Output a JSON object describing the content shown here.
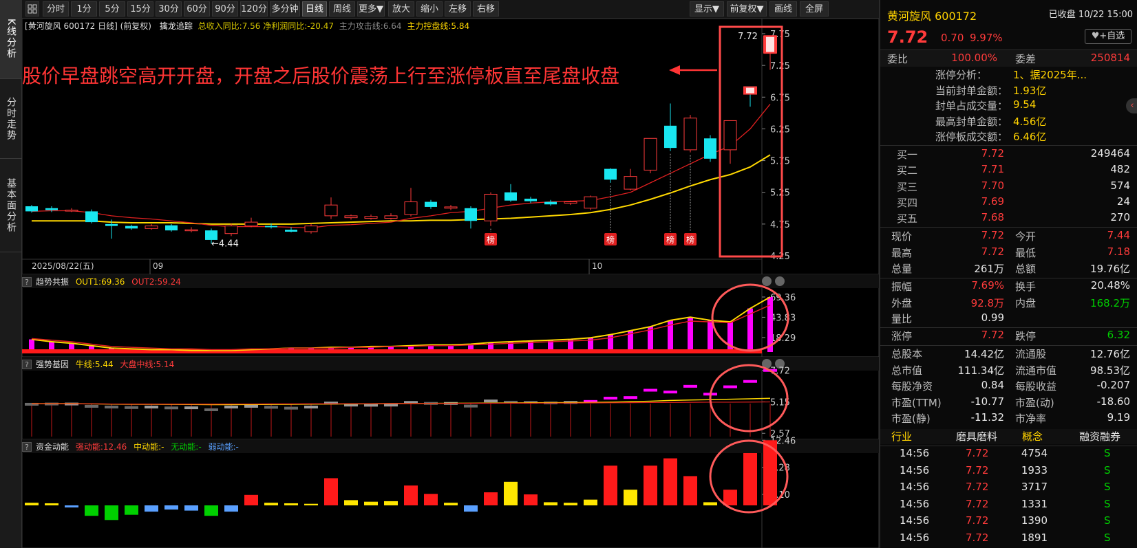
{
  "sidebar": {
    "tabs": [
      {
        "label": "K线分析"
      },
      {
        "label": "分时走势"
      },
      {
        "label": "基本面分析"
      }
    ]
  },
  "toolbar": {
    "periods": [
      "分时",
      "1分",
      "5分",
      "15分",
      "30分",
      "60分",
      "90分",
      "120分",
      "多分钟",
      "日线",
      "周线",
      "更多▼"
    ],
    "active_period": "日线",
    "actions": [
      "放大",
      "缩小",
      "左移",
      "右移"
    ],
    "right_actions": [
      "显示▼",
      "前复权▼",
      "画线",
      "全屏"
    ]
  },
  "main_panel": {
    "title_left": "[黄河旋风 600172 日线]  (前复权)",
    "indicator_name": "擒龙追踪",
    "indicator_values": "总收入同比:7.56  净利润同比:-20.47",
    "attack_line": "主力攻击线:6.64",
    "control_line": "主力控盘线:5.84",
    "price_ticks": [
      "7.75",
      "7.25",
      "6.75",
      "6.25",
      "5.75",
      "5.25",
      "4.75",
      "4.25"
    ],
    "high_label": "7.72",
    "low_label": "←4.44",
    "bang_label": "榜",
    "date_labels": [
      "2025/08/22(五)",
      "09",
      "10"
    ],
    "annotation_text": "股价早盘跳空高开开盘，开盘之后股价震荡上行至涨停板直至尾盘收盘"
  },
  "panel_trend": {
    "name": "趋势共振",
    "out1": "OUT1:69.36",
    "out2": "OUT2:59.24",
    "ticks": [
      "69.36",
      "43.83",
      "18.29"
    ]
  },
  "panel_strong": {
    "name": "强势基因",
    "bull": "牛线:5.44",
    "market": "大盘中线:5.14",
    "ticks": [
      "7.72",
      "5.15",
      "2.57"
    ]
  },
  "panel_fund": {
    "name": "资金动能",
    "strong": "强动能:12.46",
    "mid": "中动能:-",
    "none": "无动能:-",
    "weak": "弱动能:-",
    "ticks": [
      "12.46",
      "7.28",
      "2.10"
    ]
  },
  "colors": {
    "up": "#ff3b3b",
    "down": "#19e6f0",
    "ma1": "#ffd800",
    "ma2": "#e02020",
    "magenta": "#ff00ff"
  },
  "chart_data": {
    "type": "candlestick",
    "ylim": [
      4.25,
      7.75
    ],
    "candles": [
      {
        "o": 5.03,
        "c": 4.95,
        "h": 5.05,
        "l": 4.93
      },
      {
        "o": 5.0,
        "c": 4.97,
        "h": 5.03,
        "l": 4.94
      },
      {
        "o": 4.97,
        "c": 4.97,
        "h": 5.0,
        "l": 4.94
      },
      {
        "o": 4.95,
        "c": 4.78,
        "h": 4.98,
        "l": 4.76
      },
      {
        "o": 4.75,
        "c": 4.72,
        "h": 4.82,
        "l": 4.52
      },
      {
        "o": 4.72,
        "c": 4.68,
        "h": 4.74,
        "l": 4.66
      },
      {
        "o": 4.68,
        "c": 4.72,
        "h": 4.75,
        "l": 4.66
      },
      {
        "o": 4.73,
        "c": 4.65,
        "h": 4.75,
        "l": 4.63
      },
      {
        "o": 4.65,
        "c": 4.66,
        "h": 4.7,
        "l": 4.62
      },
      {
        "o": 4.65,
        "c": 4.5,
        "h": 4.68,
        "l": 4.44
      },
      {
        "o": 4.6,
        "c": 4.72,
        "h": 4.76,
        "l": 4.56
      },
      {
        "o": 4.72,
        "c": 4.78,
        "h": 4.85,
        "l": 4.7
      },
      {
        "o": 4.72,
        "c": 4.7,
        "h": 4.76,
        "l": 4.68
      },
      {
        "o": 4.66,
        "c": 4.63,
        "h": 4.7,
        "l": 4.62
      },
      {
        "o": 4.63,
        "c": 4.72,
        "h": 4.76,
        "l": 4.6
      },
      {
        "o": 4.88,
        "c": 5.05,
        "h": 5.17,
        "l": 4.83
      },
      {
        "o": 4.85,
        "c": 4.88,
        "h": 4.9,
        "l": 4.82
      },
      {
        "o": 4.84,
        "c": 4.87,
        "h": 4.9,
        "l": 4.82
      },
      {
        "o": 4.84,
        "c": 4.88,
        "h": 4.92,
        "l": 4.82
      },
      {
        "o": 4.9,
        "c": 5.1,
        "h": 5.32,
        "l": 4.87
      },
      {
        "o": 5.1,
        "c": 5.02,
        "h": 5.13,
        "l": 4.99
      },
      {
        "o": 5.0,
        "c": 5.02,
        "h": 5.05,
        "l": 4.97
      },
      {
        "o": 5.0,
        "c": 4.8,
        "h": 5.03,
        "l": 4.68
      },
      {
        "o": 4.8,
        "c": 5.22,
        "h": 5.25,
        "l": 4.72
      },
      {
        "o": 5.25,
        "c": 5.12,
        "h": 5.38,
        "l": 5.1
      },
      {
        "o": 5.15,
        "c": 5.11,
        "h": 5.18,
        "l": 5.08
      },
      {
        "o": 5.1,
        "c": 5.06,
        "h": 5.13,
        "l": 5.04
      },
      {
        "o": 5.08,
        "c": 5.1,
        "h": 5.12,
        "l": 5.05
      },
      {
        "o": 5.0,
        "c": 5.18,
        "h": 5.2,
        "l": 4.97
      },
      {
        "o": 5.62,
        "c": 5.45,
        "h": 5.63,
        "l": 5.4
      },
      {
        "o": 5.3,
        "c": 5.5,
        "h": 5.62,
        "l": 5.28
      },
      {
        "o": 5.6,
        "c": 6.1,
        "h": 6.1,
        "l": 5.55
      },
      {
        "o": 6.3,
        "c": 5.95,
        "h": 6.65,
        "l": 5.9
      },
      {
        "o": 5.92,
        "c": 6.42,
        "h": 6.47,
        "l": 5.88
      },
      {
        "o": 6.1,
        "c": 5.78,
        "h": 6.15,
        "l": 5.73
      },
      {
        "o": 5.92,
        "c": 6.38,
        "h": 6.38,
        "l": 5.7
      },
      {
        "o": 6.92,
        "c": 6.82,
        "h": 6.92,
        "l": 6.6
      },
      {
        "o": 7.44,
        "c": 7.72,
        "h": 7.72,
        "l": 7.18
      }
    ],
    "ma_control": [
      4.8,
      4.8,
      4.8,
      4.8,
      4.78,
      4.77,
      4.77,
      4.77,
      4.76,
      4.75,
      4.75,
      4.75,
      4.75,
      4.75,
      4.76,
      4.77,
      4.78,
      4.79,
      4.8,
      4.8,
      4.81,
      4.81,
      4.82,
      4.83,
      4.84,
      4.86,
      4.88,
      4.9,
      4.93,
      4.98,
      5.05,
      5.14,
      5.24,
      5.35,
      5.45,
      5.53,
      5.65,
      5.84
    ],
    "ma_attack": [
      4.95,
      4.96,
      4.96,
      4.93,
      4.88,
      4.85,
      4.83,
      4.8,
      4.77,
      4.73,
      4.71,
      4.71,
      4.71,
      4.7,
      4.69,
      4.73,
      4.74,
      4.76,
      4.78,
      4.84,
      4.88,
      4.93,
      4.95,
      5.0,
      5.05,
      5.08,
      5.1,
      5.11,
      5.12,
      5.18,
      5.25,
      5.4,
      5.55,
      5.7,
      5.85,
      5.98,
      6.25,
      6.64
    ],
    "trend": {
      "out1": [
        16,
        13,
        11,
        8,
        5,
        4,
        3,
        3,
        2,
        2,
        2,
        3,
        4,
        5,
        5,
        6,
        6,
        7,
        7,
        8,
        9,
        9,
        10,
        12,
        13,
        14,
        15,
        16,
        18,
        22,
        27,
        32,
        40,
        44,
        40,
        38,
        55,
        69.36
      ],
      "out2": [
        17,
        15,
        13,
        10,
        7,
        6,
        5,
        4,
        4,
        3,
        3,
        4,
        4,
        5,
        5,
        5,
        6,
        6,
        7,
        7,
        8,
        8,
        9,
        10,
        11,
        12,
        13,
        14,
        15,
        18,
        23,
        28,
        34,
        39,
        38,
        37,
        48,
        59.24
      ],
      "bars": [
        16,
        13,
        11,
        8,
        5,
        4,
        3,
        3,
        2,
        2,
        2,
        3,
        4,
        5,
        5,
        6,
        6,
        7,
        7,
        8,
        9,
        9,
        10,
        12,
        13,
        14,
        15,
        16,
        18,
        22,
        27,
        32,
        40,
        44,
        40,
        38,
        55,
        69.36
      ]
    },
    "strong": {
      "bull": [
        5.0,
        5.0,
        5.0,
        4.98,
        4.96,
        4.95,
        4.95,
        4.94,
        4.93,
        4.92,
        4.92,
        4.93,
        4.94,
        4.95,
        4.96,
        4.97,
        4.98,
        4.99,
        5.0,
        5.01,
        5.02,
        5.03,
        5.04,
        5.05,
        5.06,
        5.07,
        5.08,
        5.09,
        5.1,
        5.12,
        5.16,
        5.2,
        5.26,
        5.3,
        5.33,
        5.36,
        5.4,
        5.44
      ],
      "market": [
        5.0,
        5.0,
        4.99,
        4.98,
        4.97,
        4.96,
        4.96,
        4.96,
        4.96,
        4.96,
        4.97,
        4.97,
        4.98,
        4.98,
        4.99,
        4.99,
        5.0,
        5.0,
        5.01,
        5.01,
        5.02,
        5.02,
        5.03,
        5.03,
        5.04,
        5.04,
        5.05,
        5.05,
        5.06,
        5.07,
        5.08,
        5.09,
        5.1,
        5.11,
        5.12,
        5.12,
        5.13,
        5.14
      ]
    },
    "fund": [
      0.5,
      0.4,
      -0.4,
      -2.0,
      -2.8,
      -1.8,
      -1.2,
      -0.8,
      -1.0,
      -2.0,
      -1.2,
      2.0,
      0.5,
      0.4,
      0.3,
      5.2,
      1.0,
      0.7,
      0.8,
      3.8,
      2.2,
      0.5,
      -1.2,
      2.5,
      4.5,
      2.1,
      0.6,
      0.5,
      1.1,
      7.6,
      3.0,
      7.6,
      9.0,
      5.6,
      0.6,
      3.0,
      10.0,
      12.46
    ]
  },
  "right_panel": {
    "stock_name": "黄河旋风 600172",
    "status": "已收盘 10/22 15:00",
    "price": "7.72",
    "change": "0.70",
    "change_pct": "9.97%",
    "watch_button": "+自选",
    "weibi_label": "委比",
    "weibi": "100.00%",
    "weicha_label": "委差",
    "weicha": "250814",
    "limit_analysis": [
      {
        "k": "涨停分析：",
        "v": "1、据2025年..."
      },
      {
        "k": "当前封单金额：",
        "v": "1.93亿"
      },
      {
        "k": "封单占成交量：",
        "v": "9.54"
      },
      {
        "k": "最高封单金额：",
        "v": "4.56亿"
      },
      {
        "k": "涨停板成交额：",
        "v": "6.46亿"
      }
    ],
    "bids": [
      {
        "k": "买一",
        "p": "7.72",
        "v": "249464"
      },
      {
        "k": "买二",
        "p": "7.71",
        "v": "482"
      },
      {
        "k": "买三",
        "p": "7.70",
        "v": "574"
      },
      {
        "k": "买四",
        "p": "7.69",
        "v": "24"
      },
      {
        "k": "买五",
        "p": "7.68",
        "v": "270"
      }
    ],
    "stats1": [
      {
        "l1": "现价",
        "v1": "7.72",
        "c1": "red",
        "l2": "今开",
        "v2": "7.44",
        "c2": "red"
      },
      {
        "l1": "最高",
        "v1": "7.72",
        "c1": "red",
        "l2": "最低",
        "v2": "7.18",
        "c2": "red"
      },
      {
        "l1": "总量",
        "v1": "261万",
        "c1": "wht",
        "l2": "总额",
        "v2": "19.76亿",
        "c2": "wht"
      }
    ],
    "stats2": [
      {
        "l1": "振幅",
        "v1": "7.69%",
        "c1": "red",
        "l2": "换手",
        "v2": "20.48%",
        "c2": "wht"
      },
      {
        "l1": "外盘",
        "v1": "92.8万",
        "c1": "red",
        "l2": "内盘",
        "v2": "168.2万",
        "c2": "grn"
      },
      {
        "l1": "量比",
        "v1": "0.99",
        "c1": "wht",
        "l2": "",
        "v2": "",
        "c2": "wht"
      }
    ],
    "stats3": [
      {
        "l1": "涨停",
        "v1": "7.72",
        "c1": "red",
        "l2": "跌停",
        "v2": "6.32",
        "c2": "grn"
      }
    ],
    "stats4": [
      {
        "l1": "总股本",
        "v1": "14.42亿",
        "c1": "wht",
        "l2": "流通股",
        "v2": "12.76亿",
        "c2": "wht"
      },
      {
        "l1": "总市值",
        "v1": "111.34亿",
        "c1": "wht",
        "l2": "流通市值",
        "v2": "98.53亿",
        "c2": "wht"
      },
      {
        "l1": "每股净资",
        "v1": "0.84",
        "c1": "wht",
        "l2": "每股收益",
        "v2": "-0.207",
        "c2": "wht"
      },
      {
        "l1": "市盈(TTM)",
        "v1": "-10.77",
        "c1": "wht",
        "l2": "市盈(动)",
        "v2": "-18.60",
        "c2": "wht"
      },
      {
        "l1": "市盈(静)",
        "v1": "-11.32",
        "c1": "wht",
        "l2": "市净率",
        "v2": "9.19",
        "c2": "wht"
      }
    ],
    "industry_label": "行业",
    "industry": "磨具磨料",
    "concept_label": "概念",
    "margin_label": "融资融券",
    "ticks": [
      {
        "t": "14:56",
        "p": "7.72",
        "v": "4754",
        "s": "S"
      },
      {
        "t": "14:56",
        "p": "7.72",
        "v": "1933",
        "s": "S"
      },
      {
        "t": "14:56",
        "p": "7.72",
        "v": "3717",
        "s": "S"
      },
      {
        "t": "14:56",
        "p": "7.72",
        "v": "1331",
        "s": "S"
      },
      {
        "t": "14:56",
        "p": "7.72",
        "v": "1390",
        "s": "S"
      },
      {
        "t": "14:56",
        "p": "7.72",
        "v": "1891",
        "s": "S"
      }
    ]
  }
}
